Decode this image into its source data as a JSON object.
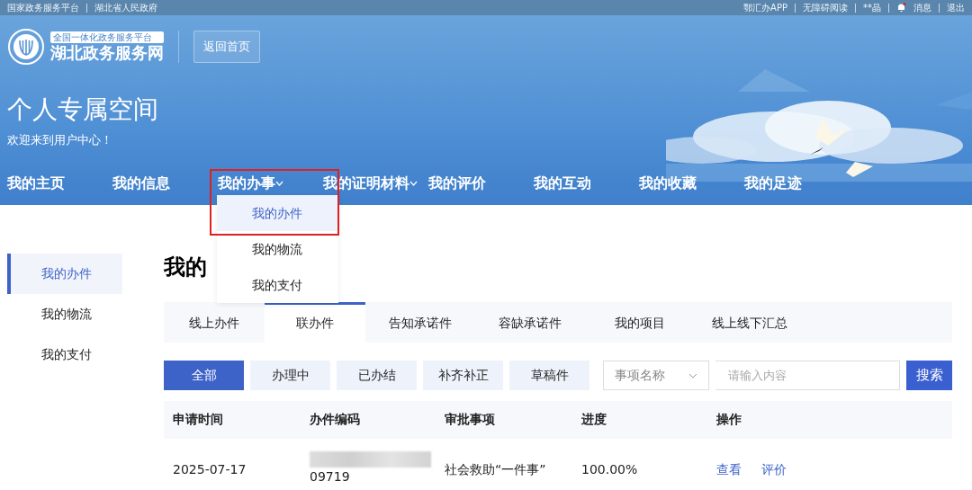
{
  "top_bar": {
    "left_links": [
      "国家政务服务平台",
      "湖北省人民政府"
    ],
    "right_links": [
      {
        "kind": "link",
        "label": "鄂汇办APP"
      },
      {
        "kind": "link",
        "label": "无障碍阅读"
      },
      {
        "kind": "link",
        "label": "**晶"
      },
      {
        "kind": "bell",
        "label": "消息",
        "unread": true
      },
      {
        "kind": "link",
        "label": "退出"
      }
    ]
  },
  "logo": {
    "tagline": "全国一体化政务服务平台",
    "name": "湖北政务服务网"
  },
  "home_button": "返回首页",
  "banner": {
    "title": "个人专属空间",
    "subtitle": "欢迎来到用户中心！"
  },
  "nav": [
    {
      "label": "我的主页",
      "dropdown": false,
      "open": false
    },
    {
      "label": "我的信息",
      "dropdown": false,
      "open": false
    },
    {
      "label": "我的办事",
      "dropdown": true,
      "open": true,
      "highlighted": true
    },
    {
      "label": "我的证明材料",
      "dropdown": true,
      "open": false
    },
    {
      "label": "我的评价",
      "dropdown": false,
      "open": false
    },
    {
      "label": "我的互动",
      "dropdown": false,
      "open": false
    },
    {
      "label": "我的收藏",
      "dropdown": false,
      "open": false
    },
    {
      "label": "我的足迹",
      "dropdown": false,
      "open": false
    }
  ],
  "nav_menu": [
    {
      "label": "我的办件",
      "selected": true
    },
    {
      "label": "我的物流",
      "selected": false
    },
    {
      "label": "我的支付",
      "selected": false
    }
  ],
  "sidebar": [
    {
      "label": "我的办件",
      "selected": true
    },
    {
      "label": "我的物流",
      "selected": false
    },
    {
      "label": "我的支付",
      "selected": false
    }
  ],
  "page_title": "我的",
  "tabs": [
    {
      "label": "线上办件",
      "selected": false
    },
    {
      "label": "联办件",
      "selected": true
    },
    {
      "label": "告知承诺件",
      "selected": false
    },
    {
      "label": "容缺承诺件",
      "selected": false
    },
    {
      "label": "我的项目",
      "selected": false
    },
    {
      "label": "线上线下汇总",
      "selected": false
    }
  ],
  "filters": [
    {
      "label": "全部",
      "selected": true
    },
    {
      "label": "办理中",
      "selected": false
    },
    {
      "label": "已办结",
      "selected": false
    },
    {
      "label": "补齐补正",
      "selected": false
    },
    {
      "label": "草稿件",
      "selected": false
    }
  ],
  "search": {
    "field_select": "事项名称",
    "placeholder": "请输入内容",
    "button": "搜索"
  },
  "table": {
    "columns": [
      "申请时间",
      "办件编码",
      "审批事项",
      "进度",
      "操作"
    ],
    "rows": [
      {
        "date": "2025-07-17",
        "code": "09719",
        "code_redacted": true,
        "item": "社会救助“一件事”",
        "progress": "100.00%",
        "actions": [
          "查看",
          "评价"
        ]
      }
    ]
  }
}
